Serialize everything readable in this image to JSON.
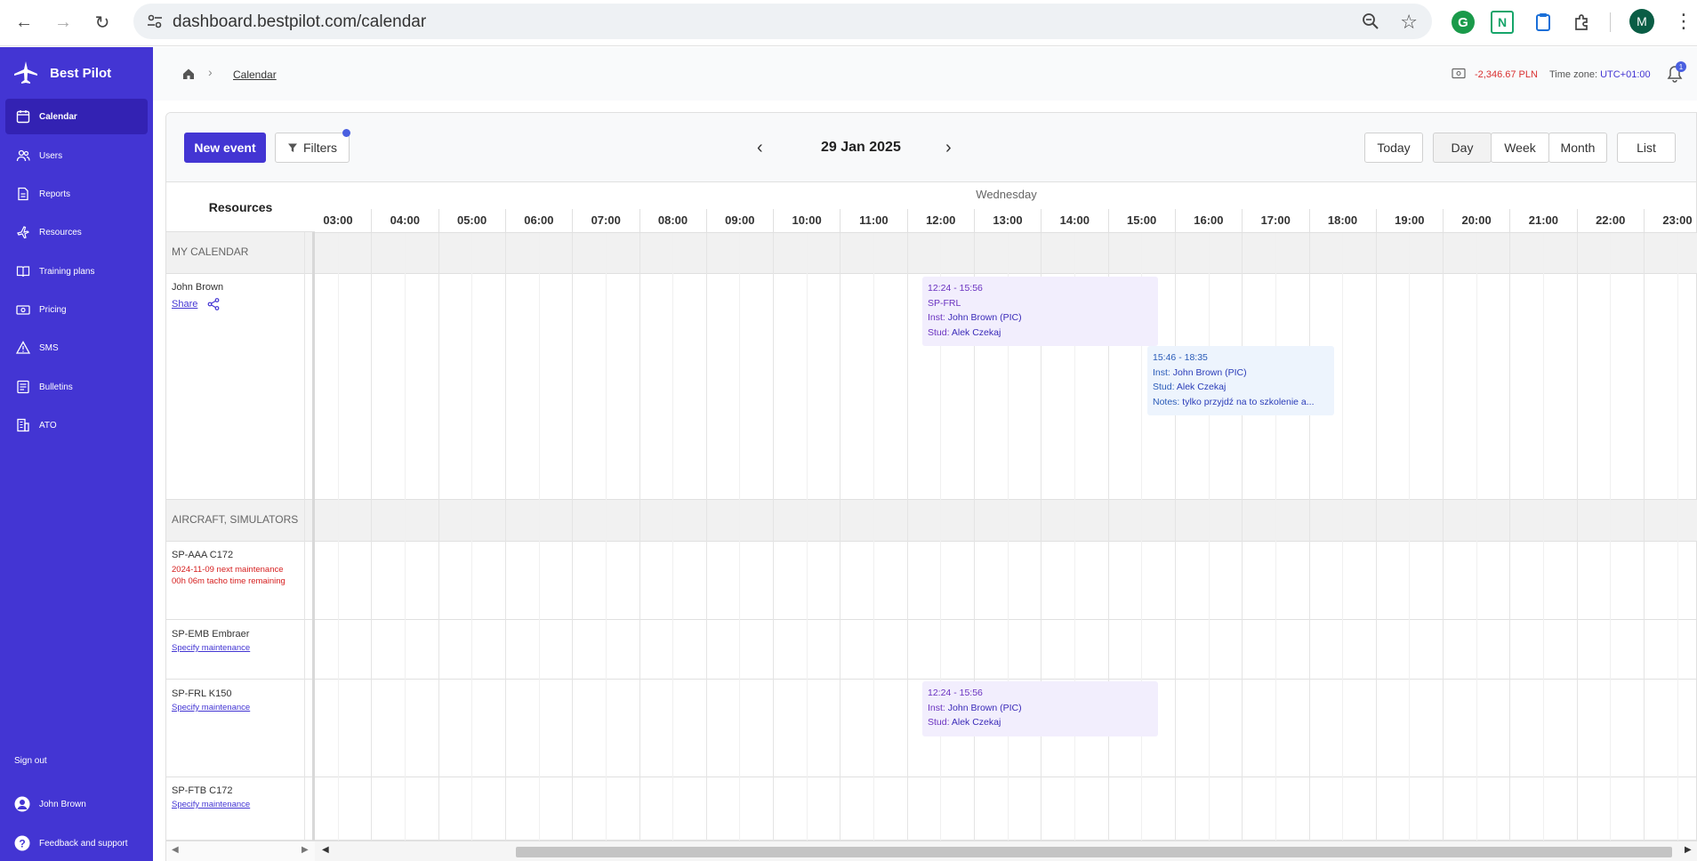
{
  "browser": {
    "url": "dashboard.bestpilot.com/calendar",
    "profile_initial": "M"
  },
  "sidebar": {
    "brand": "Best Pilot",
    "items": [
      {
        "label": "Calendar",
        "icon": "calendar-icon",
        "active": true
      },
      {
        "label": "Users",
        "icon": "users-icon"
      },
      {
        "label": "Reports",
        "icon": "reports-icon"
      },
      {
        "label": "Resources",
        "icon": "plane-icon"
      },
      {
        "label": "Training plans",
        "icon": "book-icon"
      },
      {
        "label": "Pricing",
        "icon": "cash-icon"
      },
      {
        "label": "SMS",
        "icon": "warning-icon"
      },
      {
        "label": "Bulletins",
        "icon": "bulletin-icon"
      },
      {
        "label": "ATO",
        "icon": "building-icon"
      }
    ],
    "sign_out": "Sign out",
    "user": "John Brown",
    "feedback": "Feedback and support"
  },
  "header": {
    "breadcrumb": "Calendar",
    "balance": "-2,346.67 PLN",
    "timezone_label": "Time zone:",
    "timezone_value": "UTC+01:00",
    "notifications": "1"
  },
  "toolbar": {
    "new_event": "New event",
    "filters": "Filters",
    "date": "29 Jan 2025",
    "today": "Today",
    "day": "Day",
    "week": "Week",
    "month": "Month",
    "list": "List"
  },
  "calendar": {
    "resources_header": "Resources",
    "weekday": "Wednesday",
    "hours": [
      "03:00",
      "04:00",
      "05:00",
      "06:00",
      "07:00",
      "08:00",
      "09:00",
      "10:00",
      "11:00",
      "12:00",
      "13:00",
      "14:00",
      "15:00",
      "16:00",
      "17:00",
      "18:00",
      "19:00",
      "20:00",
      "21:00",
      "22:00",
      "23:00"
    ],
    "groups": {
      "my_calendar": "MY CALENDAR",
      "aircraft": "AIRCRAFT, SIMULATORS"
    },
    "resources": {
      "john": {
        "name": "John Brown",
        "share": "Share"
      },
      "aaa": {
        "name": "SP-AAA C172",
        "line1": "2024-11-09 next maintenance",
        "line2": "00h 06m tacho time remaining"
      },
      "emb": {
        "name": "SP-EMB Embraer",
        "link": "Specify maintenance"
      },
      "frl": {
        "name": "SP-FRL K150",
        "link": "Specify maintenance"
      },
      "ftb": {
        "name": "SP-FTB C172",
        "link": "Specify maintenance"
      }
    },
    "events": {
      "e1": {
        "time": "12:24 - 15:56",
        "aircraft": "SP-FRL",
        "inst_label": "Inst:",
        "inst": "John Brown (PIC)",
        "stud_label": "Stud:",
        "stud": "Alek Czekaj"
      },
      "e2": {
        "time": "15:46 - 18:35",
        "inst_label": "Inst:",
        "inst": "John Brown (PIC)",
        "stud_label": "Stud:",
        "stud": "Alek Czekaj",
        "notes_label": "Notes:",
        "notes": "tylko przyjdź na to szkolenie a..."
      },
      "e3": {
        "time": "12:24 - 15:56",
        "inst_label": "Inst:",
        "inst": "John Brown (PIC)",
        "stud_label": "Stud:",
        "stud": "Alek Czekaj"
      }
    }
  },
  "colors": {
    "accent": "#4335d3",
    "danger": "#d93030",
    "event_purple": "#f2eefd",
    "event_blue": "#edf4fd"
  }
}
